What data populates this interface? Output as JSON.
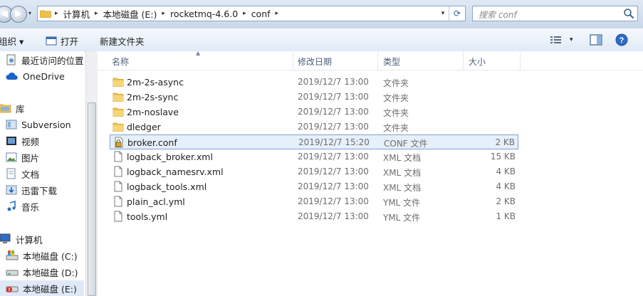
{
  "address": {
    "crumbs": [
      "计算机",
      "本地磁盘 (E:)",
      "rocketmq-4.6.0",
      "conf"
    ]
  },
  "search": {
    "placeholder": "搜索 conf"
  },
  "toolbar": {
    "organize_label": "组织 ▾",
    "open_label": "打开",
    "new_folder_label": "新建文件夹"
  },
  "sidebar": {
    "items": [
      {
        "label": "最近访问的位置",
        "icon": "recent-places-icon"
      },
      {
        "label": "OneDrive",
        "icon": "cloud-icon"
      },
      {
        "label": "库",
        "icon": "library-icon"
      },
      {
        "label": "Subversion",
        "icon": "library-folder-icon"
      },
      {
        "label": "视频",
        "icon": "video-icon"
      },
      {
        "label": "图片",
        "icon": "picture-icon"
      },
      {
        "label": "文档",
        "icon": "document-icon"
      },
      {
        "label": "迅雷下载",
        "icon": "download-icon"
      },
      {
        "label": "音乐",
        "icon": "music-icon"
      },
      {
        "label": "计算机",
        "icon": "computer-icon"
      },
      {
        "label": "本地磁盘 (C:)",
        "icon": "drive-icon"
      },
      {
        "label": "本地磁盘 (D:)",
        "icon": "drive-icon"
      },
      {
        "label": "本地磁盘 (E:)",
        "icon": "drive-icon"
      }
    ]
  },
  "columns": {
    "name": "名称",
    "modified": "修改日期",
    "type": "类型",
    "size": "大小"
  },
  "files": [
    {
      "name": "2m-2s-async",
      "modified": "2019/12/7 13:00",
      "type": "文件夹",
      "size": "",
      "kind": "folder"
    },
    {
      "name": "2m-2s-sync",
      "modified": "2019/12/7 13:00",
      "type": "文件夹",
      "size": "",
      "kind": "folder"
    },
    {
      "name": "2m-noslave",
      "modified": "2019/12/7 13:00",
      "type": "文件夹",
      "size": "",
      "kind": "folder"
    },
    {
      "name": "dledger",
      "modified": "2019/12/7 13:00",
      "type": "文件夹",
      "size": "",
      "kind": "folder"
    },
    {
      "name": "broker.conf",
      "modified": "2019/12/7 15:20",
      "type": "CONF 文件",
      "size": "2 KB",
      "kind": "locked-file"
    },
    {
      "name": "logback_broker.xml",
      "modified": "2019/12/7 13:00",
      "type": "XML 文档",
      "size": "15 KB",
      "kind": "file"
    },
    {
      "name": "logback_namesrv.xml",
      "modified": "2019/12/7 13:00",
      "type": "XML 文档",
      "size": "4 KB",
      "kind": "file"
    },
    {
      "name": "logback_tools.xml",
      "modified": "2019/12/7 13:00",
      "type": "XML 文档",
      "size": "4 KB",
      "kind": "file"
    },
    {
      "name": "plain_acl.yml",
      "modified": "2019/12/7 13:00",
      "type": "YML 文件",
      "size": "2 KB",
      "kind": "file"
    },
    {
      "name": "tools.yml",
      "modified": "2019/12/7 13:00",
      "type": "YML 文件",
      "size": "1 KB",
      "kind": "file"
    }
  ],
  "colors": {
    "selection": "#e6f0fb",
    "selection_border": "#7da2ce",
    "folder": "#f0c24d"
  }
}
